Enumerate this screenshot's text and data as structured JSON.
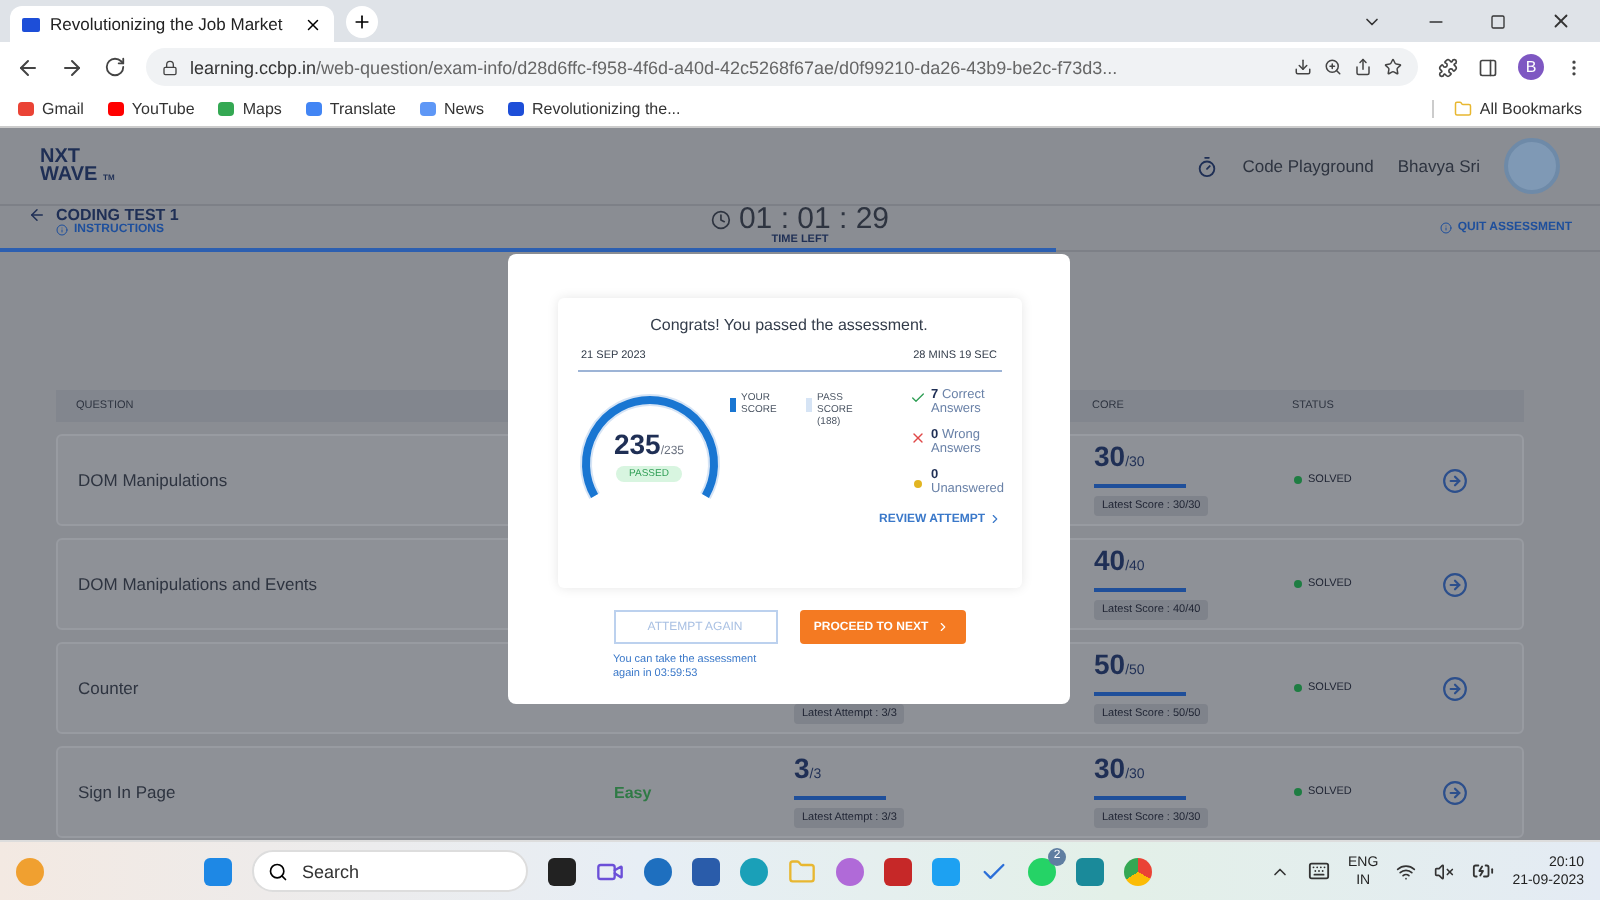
{
  "browser": {
    "tab_title": "Revolutionizing the Job Market",
    "url_host": "learning.ccbp.in",
    "url_path": "/web-question/exam-info/d28d6ffc-f958-4f6d-a40d-42c5268f67ae/d0f99210-da26-43b9-be2c-f73d3...",
    "profile": "B",
    "bookmarks": [
      {
        "label": "Gmail",
        "color": "#ea4335"
      },
      {
        "label": "YouTube",
        "color": "#ff0000"
      },
      {
        "label": "Maps",
        "color": "#34a853"
      },
      {
        "label": "Translate",
        "color": "#4285f4"
      },
      {
        "label": "News",
        "color": "#5e97f6"
      },
      {
        "label": "Revolutionizing the...",
        "color": "#1d4ed8"
      }
    ],
    "all_bookmarks": "All Bookmarks"
  },
  "header": {
    "logo_top": "NXT",
    "logo_bottom": "WAVE",
    "logo_mark": "TM",
    "code_playground": "Code Playground",
    "user": "Bhavya Sri"
  },
  "test_bar": {
    "title": "CODING TEST 1",
    "instructions": "INSTRUCTIONS",
    "timer": "01 : 01 : 29",
    "timer_label": "TIME LEFT",
    "quit": "QUIT ASSESSMENT",
    "level": 0.66
  },
  "table": {
    "columns": [
      "QUESTION",
      "CORE",
      "STATUS"
    ],
    "rows": [
      {
        "question": "DOM Manipulations",
        "score": {
          "value": "30",
          "total": "/30",
          "level": 1,
          "latest": "Latest Score : 30/30"
        },
        "status": "SOLVED"
      },
      {
        "question": "DOM Manipulations and Events",
        "score": {
          "value": "40",
          "total": "/40",
          "level": 1,
          "latest": "Latest Score : 40/40"
        },
        "status": "SOLVED"
      },
      {
        "question": "Counter",
        "attempts": {
          "latest": "Latest Attempt : 3/3"
        },
        "score": {
          "value": "50",
          "total": "/50",
          "level": 1,
          "latest": "Latest Score : 50/50"
        },
        "status": "SOLVED"
      },
      {
        "question": "Sign In Page",
        "difficulty": "Easy",
        "attempts": {
          "value": "3",
          "total": "/3",
          "level": 1,
          "latest": "Latest Attempt : 3/3"
        },
        "score": {
          "value": "30",
          "total": "/30",
          "level": 1,
          "latest": "Latest Score : 30/30"
        },
        "status": "SOLVED"
      }
    ]
  },
  "modal": {
    "heading": "Congrats! You passed the assessment.",
    "date": "21 SEP 2023",
    "duration": "28 MINS 19 SEC",
    "score": {
      "value": "235",
      "total": "/235",
      "result": "PASSED"
    },
    "legend": [
      {
        "label": "YOUR SCORE",
        "color": "#1976d2"
      },
      {
        "label": "PASS SCORE (188)",
        "color": "#d6e4f5"
      }
    ],
    "stats": [
      {
        "kind": "correct",
        "count": "7",
        "label": "Correct Answers"
      },
      {
        "kind": "wrong",
        "count": "0",
        "label": "Wrong Answers"
      },
      {
        "kind": "unanswered",
        "count": "0",
        "label": "Unanswered"
      }
    ],
    "review": "REVIEW ATTEMPT",
    "attempt_again": {
      "label": "ATTEMPT AGAIN",
      "disabled": true
    },
    "proceed": "PROCEED TO NEXT",
    "note": "You can take the assessment again in 03:59:53"
  },
  "taskbar": {
    "search_placeholder": "Search",
    "whatsapp_badge": "2",
    "lang_top": "ENG",
    "lang_bottom": "IN",
    "time": "20:10",
    "date": "21-09-2023"
  }
}
